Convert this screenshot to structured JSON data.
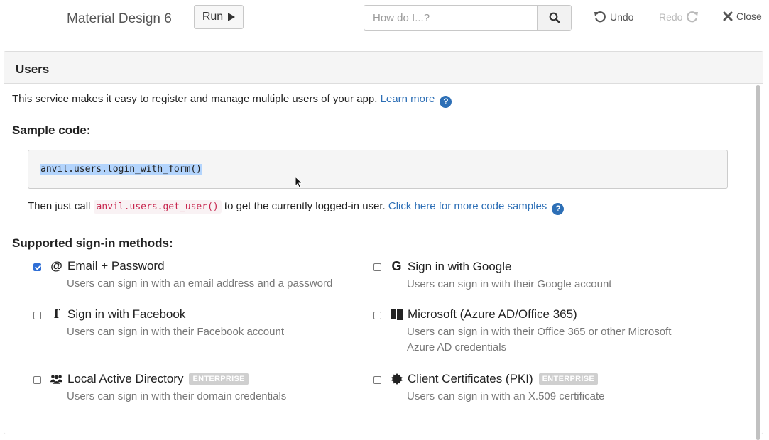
{
  "toolbar": {
    "app_title": "Material Design 6",
    "run_label": "Run",
    "search_placeholder": "How do I...?",
    "undo_label": "Undo",
    "redo_label": "Redo",
    "close_label": "Close"
  },
  "panel": {
    "title": "Users",
    "intro": "This service makes it easy to register and manage multiple users of your app.",
    "learn_more": "Learn more",
    "sample_heading": "Sample code:",
    "code": "anvil.users.login_with_form()",
    "then_prefix": "Then just call",
    "then_code": "anvil.users.get_user()",
    "then_suffix": "to get the currently logged-in user.",
    "more_samples": "Click here for more code samples",
    "methods_heading": "Supported sign-in methods:"
  },
  "methods": [
    {
      "icon": "at-icon",
      "label": "Email + Password",
      "desc": "Users can sign in with an email address and a password",
      "checked": true
    },
    {
      "icon": "google-icon",
      "label": "Sign in with Google",
      "desc": "Users can sign in with their Google account",
      "checked": false
    },
    {
      "icon": "facebook-icon",
      "label": "Sign in with Facebook",
      "desc": "Users can sign in with their Facebook account",
      "checked": false
    },
    {
      "icon": "windows-icon",
      "label": "Microsoft (Azure AD/Office 365)",
      "desc": "Users can sign in with their Office 365 or other Microsoft Azure AD credentials",
      "checked": false
    },
    {
      "icon": "users-icon",
      "label": "Local Active Directory",
      "badge": "ENTERPRISE",
      "desc": "Users can sign in with their domain credentials",
      "checked": false
    },
    {
      "icon": "certificate-icon",
      "label": "Client Certificates (PKI)",
      "badge": "ENTERPRISE",
      "desc": "Users can sign in with an X.509 certificate",
      "checked": false
    }
  ],
  "colors": {
    "link": "#2d6fb6",
    "checkbox_checked": "#2f6fd6",
    "inline_code": "#c7254e",
    "badge": "#cfcfcf"
  }
}
